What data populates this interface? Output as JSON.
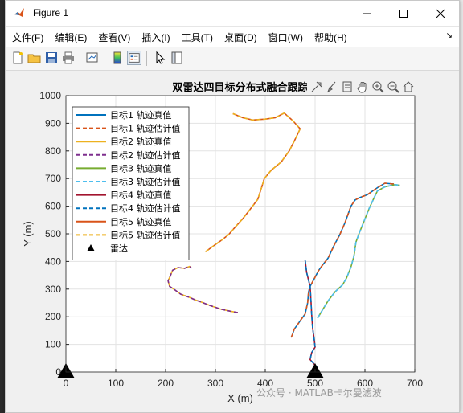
{
  "window": {
    "title": "Figure 1",
    "buttons": [
      "minimize",
      "maximize",
      "close"
    ]
  },
  "menu": [
    "文件(F)",
    "编辑(E)",
    "查看(V)",
    "插入(I)",
    "工具(T)",
    "桌面(D)",
    "窗口(W)",
    "帮助(H)"
  ],
  "toolbar_icons": [
    "new-figure-icon",
    "open-file-icon",
    "save-icon",
    "print-icon",
    "link-plot-icon",
    "colorbar-icon",
    "legend-icon",
    "select-arrow-icon",
    "property-inspector-icon"
  ],
  "axes_toolbar_icons": [
    "data-tip-icon",
    "brush-icon",
    "restore-icon",
    "pan-icon",
    "zoom-in-icon",
    "zoom-out-icon",
    "home-icon"
  ],
  "watermark": "公众号 · MATLAB卡尔曼滤波",
  "chart_data": {
    "type": "line",
    "title": "双雷达四目标分布式融合跟踪",
    "xlabel": "X (m)",
    "ylabel": "Y (m)",
    "xlim": [
      0,
      700
    ],
    "ylim": [
      0,
      1000
    ],
    "xticks": [
      "0",
      "100",
      "200",
      "300",
      "400",
      "500",
      "600",
      "700"
    ],
    "yticks": [
      "0",
      "100",
      "200",
      "300",
      "400",
      "500",
      "600",
      "700",
      "800",
      "900",
      "1000"
    ],
    "grid": true,
    "legend_position": "top-left",
    "series": [
      {
        "name": "目标1 轨迹真值",
        "style": "solid",
        "color": "#0072bd",
        "points": [
          [
            658,
            680
          ],
          [
            640,
            683
          ],
          [
            625,
            667
          ],
          [
            605,
            642
          ],
          [
            588,
            630
          ],
          [
            580,
            622
          ],
          [
            572,
            600
          ],
          [
            567,
            575
          ],
          [
            560,
            540
          ],
          [
            549,
            495
          ],
          [
            540,
            465
          ],
          [
            532,
            435
          ],
          [
            526,
            412
          ],
          [
            514,
            385
          ],
          [
            507,
            367
          ],
          [
            499,
            340
          ],
          [
            490,
            310
          ],
          [
            487,
            290
          ],
          [
            485,
            250
          ],
          [
            480,
            210
          ],
          [
            472,
            190
          ],
          [
            465,
            172
          ],
          [
            458,
            155
          ],
          [
            455,
            138
          ],
          [
            452,
            125
          ]
        ]
      },
      {
        "name": "目标1 轨迹估计值",
        "style": "dashed",
        "color": "#d95319",
        "points": [
          [
            658,
            680
          ],
          [
            640,
            683
          ],
          [
            625,
            667
          ],
          [
            605,
            642
          ],
          [
            588,
            630
          ],
          [
            580,
            622
          ],
          [
            572,
            600
          ],
          [
            567,
            575
          ],
          [
            560,
            540
          ],
          [
            549,
            495
          ],
          [
            540,
            465
          ],
          [
            532,
            435
          ],
          [
            526,
            412
          ],
          [
            514,
            385
          ],
          [
            507,
            367
          ],
          [
            499,
            340
          ],
          [
            490,
            310
          ],
          [
            487,
            290
          ],
          [
            485,
            250
          ],
          [
            480,
            210
          ],
          [
            472,
            190
          ],
          [
            465,
            172
          ],
          [
            458,
            155
          ],
          [
            455,
            138
          ],
          [
            452,
            125
          ]
        ]
      },
      {
        "name": "目标2 轨迹真值",
        "style": "solid",
        "color": "#edb120",
        "points": [
          [
            345,
            215
          ],
          [
            330,
            220
          ],
          [
            310,
            228
          ],
          [
            290,
            240
          ],
          [
            273,
            252
          ],
          [
            258,
            262
          ],
          [
            248,
            270
          ],
          [
            230,
            282
          ],
          [
            218,
            298
          ],
          [
            208,
            310
          ],
          [
            205,
            330
          ],
          [
            210,
            350
          ],
          [
            214,
            368
          ],
          [
            225,
            378
          ],
          [
            238,
            375
          ],
          [
            248,
            382
          ],
          [
            252,
            375
          ]
        ]
      },
      {
        "name": "目标2 轨迹估计值",
        "style": "dashed",
        "color": "#7e2f8e",
        "points": [
          [
            345,
            215
          ],
          [
            330,
            220
          ],
          [
            310,
            228
          ],
          [
            290,
            240
          ],
          [
            273,
            252
          ],
          [
            258,
            262
          ],
          [
            248,
            270
          ],
          [
            230,
            282
          ],
          [
            218,
            298
          ],
          [
            208,
            310
          ],
          [
            205,
            330
          ],
          [
            210,
            350
          ],
          [
            214,
            368
          ],
          [
            225,
            378
          ],
          [
            238,
            375
          ],
          [
            248,
            382
          ],
          [
            252,
            375
          ]
        ]
      },
      {
        "name": "目标3 轨迹真值",
        "style": "solid",
        "color": "#77ac30",
        "points": [
          [
            505,
            195
          ],
          [
            515,
            225
          ],
          [
            527,
            260
          ],
          [
            540,
            290
          ],
          [
            555,
            315
          ],
          [
            563,
            340
          ],
          [
            572,
            380
          ],
          [
            578,
            420
          ],
          [
            582,
            470
          ],
          [
            589,
            505
          ],
          [
            598,
            545
          ],
          [
            608,
            590
          ],
          [
            617,
            625
          ],
          [
            625,
            655
          ],
          [
            640,
            670
          ],
          [
            660,
            678
          ],
          [
            670,
            676
          ]
        ]
      },
      {
        "name": "目标3 轨迹估计值",
        "style": "dashed",
        "color": "#4dbeee",
        "points": [
          [
            505,
            195
          ],
          [
            515,
            225
          ],
          [
            527,
            260
          ],
          [
            540,
            290
          ],
          [
            555,
            315
          ],
          [
            563,
            340
          ],
          [
            572,
            380
          ],
          [
            578,
            420
          ],
          [
            582,
            470
          ],
          [
            589,
            505
          ],
          [
            598,
            545
          ],
          [
            608,
            590
          ],
          [
            617,
            625
          ],
          [
            625,
            655
          ],
          [
            640,
            670
          ],
          [
            660,
            678
          ],
          [
            670,
            676
          ]
        ]
      },
      {
        "name": "目标4 轨迹真值",
        "style": "solid",
        "color": "#a2142f",
        "points": [
          [
            480,
            405
          ],
          [
            483,
            360
          ],
          [
            490,
            310
          ],
          [
            492,
            250
          ],
          [
            493,
            210
          ],
          [
            495,
            160
          ],
          [
            498,
            120
          ],
          [
            500,
            90
          ],
          [
            493,
            70
          ],
          [
            490,
            45
          ],
          [
            500,
            25
          ],
          [
            505,
            15
          ]
        ]
      },
      {
        "name": "目标4 轨迹估计值",
        "style": "dashed",
        "color": "#0072bd",
        "points": [
          [
            480,
            405
          ],
          [
            483,
            360
          ],
          [
            490,
            310
          ],
          [
            492,
            250
          ],
          [
            493,
            210
          ],
          [
            495,
            160
          ],
          [
            498,
            120
          ],
          [
            500,
            90
          ],
          [
            493,
            70
          ],
          [
            490,
            45
          ],
          [
            500,
            25
          ],
          [
            505,
            15
          ]
        ]
      },
      {
        "name": "目标5 轨迹真值",
        "style": "solid",
        "color": "#d95319",
        "points": [
          [
            280,
            435
          ],
          [
            295,
            455
          ],
          [
            313,
            478
          ],
          [
            327,
            498
          ],
          [
            340,
            525
          ],
          [
            355,
            555
          ],
          [
            368,
            585
          ],
          [
            385,
            625
          ],
          [
            393,
            670
          ],
          [
            398,
            700
          ],
          [
            412,
            730
          ],
          [
            432,
            760
          ],
          [
            448,
            800
          ],
          [
            458,
            835
          ],
          [
            470,
            880
          ],
          [
            455,
            910
          ],
          [
            438,
            937
          ],
          [
            420,
            920
          ],
          [
            400,
            915
          ],
          [
            375,
            912
          ],
          [
            355,
            920
          ],
          [
            335,
            935
          ]
        ]
      },
      {
        "name": "目标5 轨迹估计值",
        "style": "dashed",
        "color": "#edb120",
        "points": [
          [
            280,
            435
          ],
          [
            295,
            455
          ],
          [
            313,
            478
          ],
          [
            327,
            498
          ],
          [
            340,
            525
          ],
          [
            355,
            555
          ],
          [
            368,
            585
          ],
          [
            385,
            625
          ],
          [
            393,
            670
          ],
          [
            398,
            700
          ],
          [
            412,
            730
          ],
          [
            432,
            760
          ],
          [
            448,
            800
          ],
          [
            458,
            835
          ],
          [
            470,
            880
          ],
          [
            455,
            910
          ],
          [
            438,
            937
          ],
          [
            420,
            920
          ],
          [
            400,
            915
          ],
          [
            375,
            912
          ],
          [
            355,
            920
          ],
          [
            335,
            935
          ]
        ]
      },
      {
        "name": "雷达",
        "style": "marker",
        "marker": "triangle",
        "color": "#000000",
        "points": [
          [
            0,
            0
          ],
          [
            500,
            0
          ]
        ]
      }
    ]
  }
}
